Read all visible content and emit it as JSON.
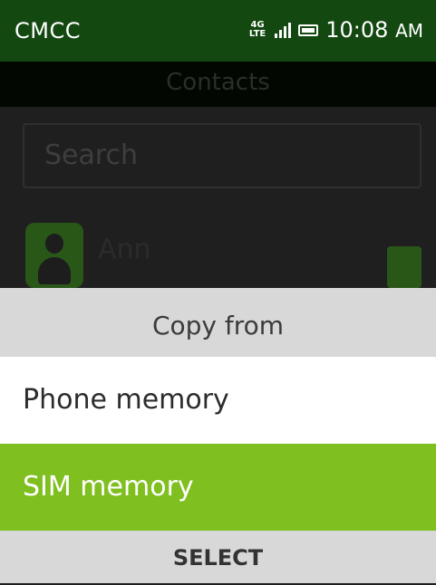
{
  "status_bar": {
    "carrier": "CMCC",
    "network_top": "4G",
    "network_bottom": "LTE",
    "time": "10:08",
    "ampm": "AM",
    "icons": [
      "signal-icon",
      "battery-icon"
    ]
  },
  "header": {
    "title": "Contacts"
  },
  "search": {
    "placeholder": "Search"
  },
  "contacts": [
    {
      "name": "Ann",
      "icon": "person-avatar-icon",
      "source_icon": "sim-card-icon"
    }
  ],
  "dialog": {
    "title": "Copy from",
    "options": [
      {
        "label": "Phone memory",
        "selected": false
      },
      {
        "label": "SIM memory",
        "selected": true
      }
    ]
  },
  "softkeys": {
    "center": "SELECT"
  },
  "colors": {
    "status_bar_bg": "#134810",
    "accent": "#7fbf1f",
    "dialog_header_bg": "#d8d8d8"
  }
}
